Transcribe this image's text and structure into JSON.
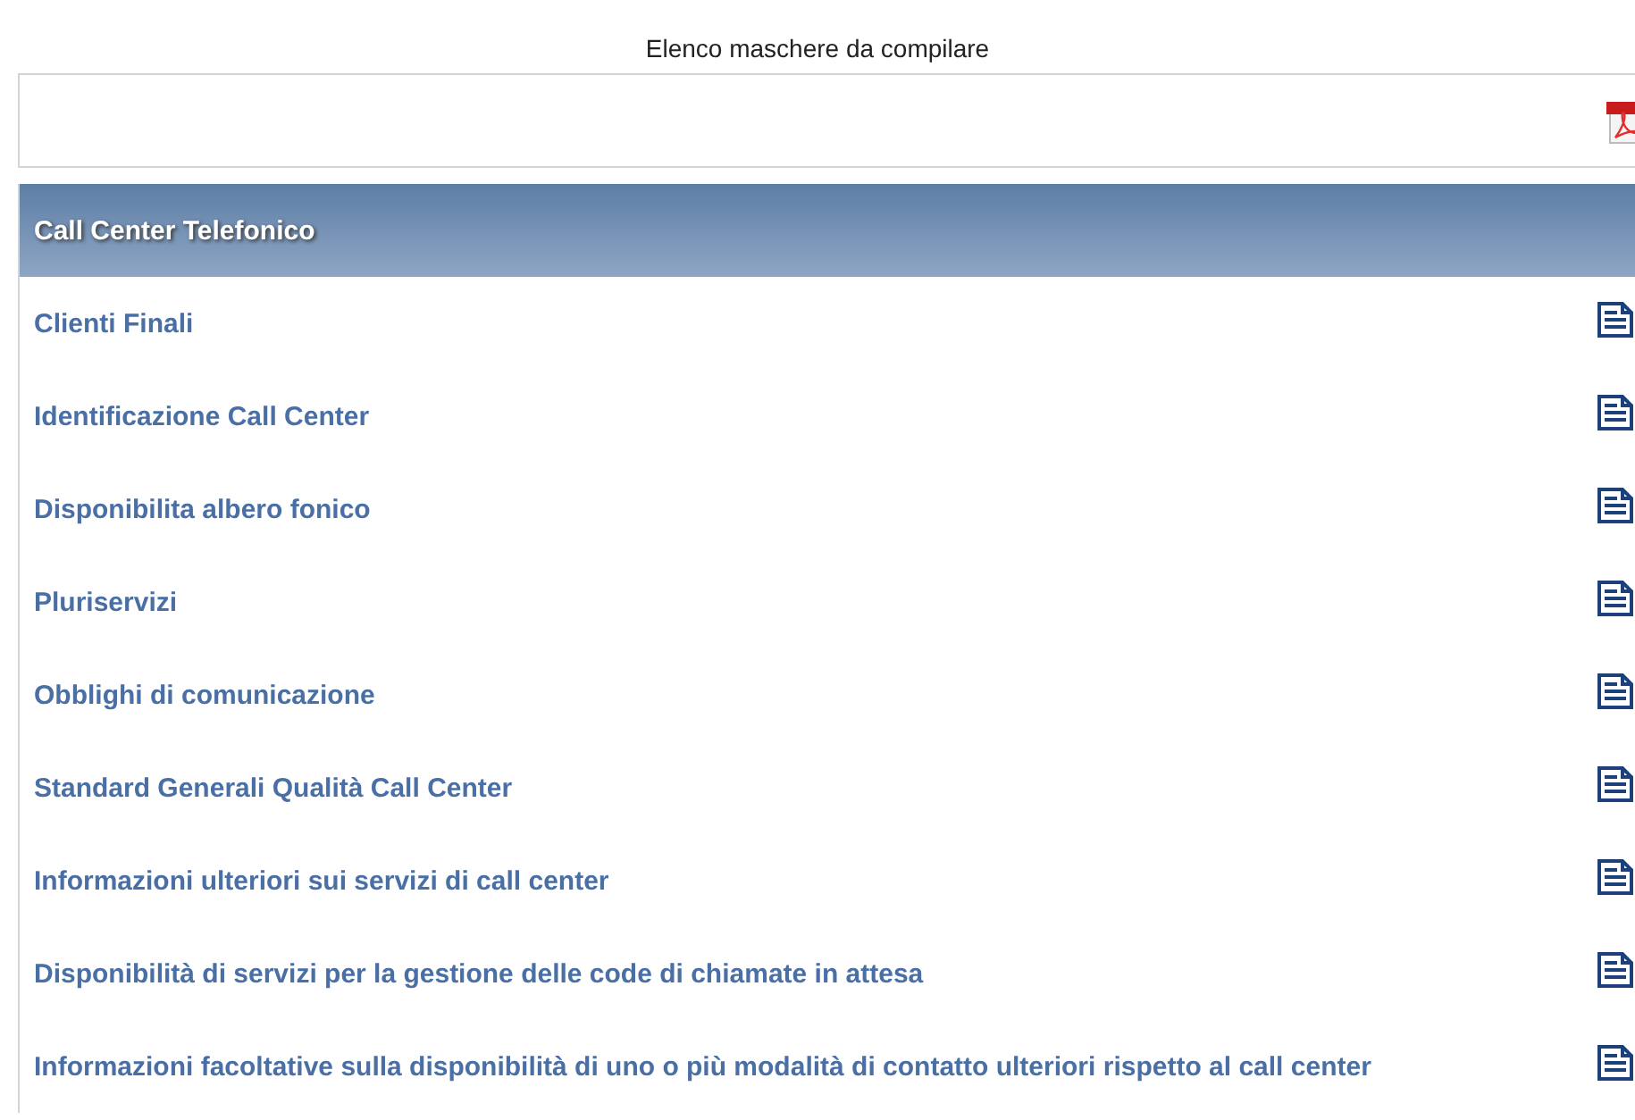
{
  "page_title": "Elenco maschere da compilare",
  "section": {
    "title": "Call Center Telefonico"
  },
  "rows": [
    {
      "label": "Clienti Finali"
    },
    {
      "label": "Identificazione Call Center"
    },
    {
      "label": "Disponibilita albero fonico"
    },
    {
      "label": "Pluriservizi"
    },
    {
      "label": "Obblighi di comunicazione"
    },
    {
      "label": "Standard Generali Qualità Call Center"
    },
    {
      "label": "Informazioni ulteriori sui servizi di call center"
    },
    {
      "label": "Disponibilità di servizi per la gestione delle code di chiamate in attesa"
    },
    {
      "label": "Informazioni facoltative sulla disponibilità di uno o più modalità di contatto ulteriori rispetto al call center"
    }
  ]
}
